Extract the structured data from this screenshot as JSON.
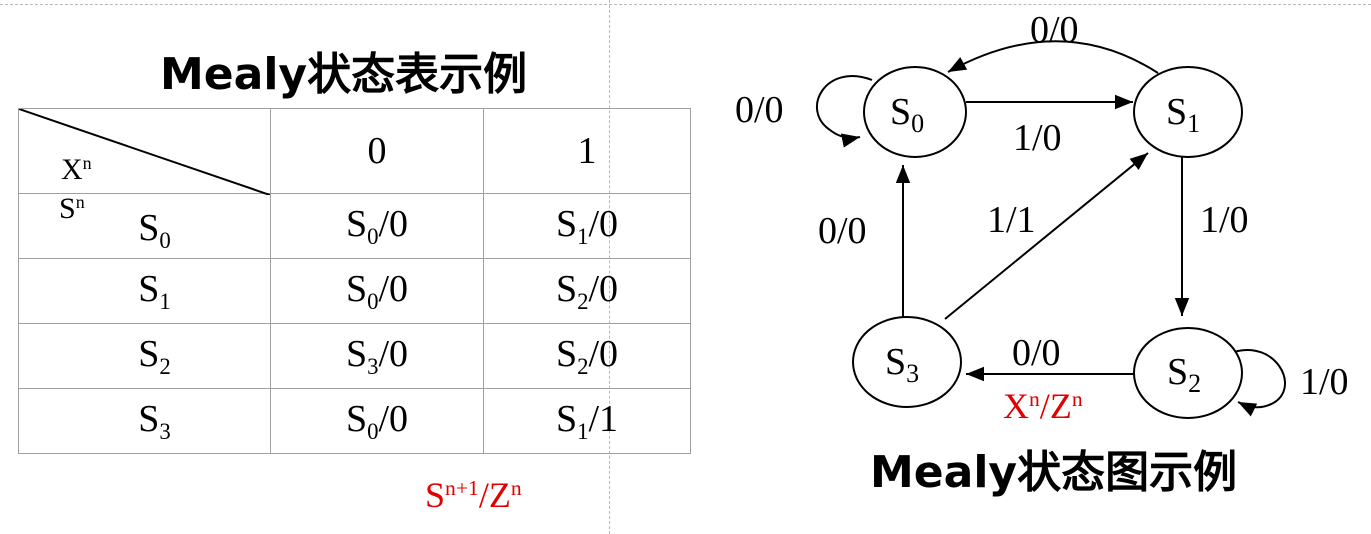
{
  "table_title": "Mealy状态表示例",
  "diagram_title": "Mealy状态图示例",
  "table": {
    "corner_input_label": "X",
    "corner_input_sup": "n",
    "corner_state_label": "S",
    "corner_state_sup": "n",
    "columns": [
      "0",
      "1"
    ],
    "rows": [
      {
        "state": "S",
        "sub": "0",
        "c0": {
          "s": "S",
          "sub": "0",
          "out": "/0"
        },
        "c1": {
          "s": "S",
          "sub": "1",
          "out": "/0"
        }
      },
      {
        "state": "S",
        "sub": "1",
        "c0": {
          "s": "S",
          "sub": "0",
          "out": "/0"
        },
        "c1": {
          "s": "S",
          "sub": "2",
          "out": "/0"
        }
      },
      {
        "state": "S",
        "sub": "2",
        "c0": {
          "s": "S",
          "sub": "3",
          "out": "/0"
        },
        "c1": {
          "s": "S",
          "sub": "2",
          "out": "/0"
        }
      },
      {
        "state": "S",
        "sub": "3",
        "c0": {
          "s": "S",
          "sub": "0",
          "out": "/0"
        },
        "c1": {
          "s": "S",
          "sub": "1",
          "out": "/1"
        }
      }
    ],
    "caption": {
      "s": "S",
      "s_sup": "n+1",
      "sep": "/",
      "z": "Z",
      "z_sup": "n"
    }
  },
  "diagram": {
    "nodes": {
      "S0": {
        "label": "S",
        "sub": "0"
      },
      "S1": {
        "label": "S",
        "sub": "1"
      },
      "S2": {
        "label": "S",
        "sub": "2"
      },
      "S3": {
        "label": "S",
        "sub": "3"
      }
    },
    "edge_labels": {
      "s0_self": "0/0",
      "s1_to_s0": "0/0",
      "s0_to_s1": "1/0",
      "s1_to_s2": "1/0",
      "s3_to_s1": "1/1",
      "s3_to_s0": "0/0",
      "s2_to_s3": "0/0",
      "s2_self": "1/0"
    },
    "caption": {
      "x": "X",
      "x_sup": "n",
      "sep": "/",
      "z": "Z",
      "z_sup": "n"
    }
  },
  "colors": {
    "caption": "#e00000",
    "grid": "#a0a0a0",
    "line": "#000000"
  }
}
